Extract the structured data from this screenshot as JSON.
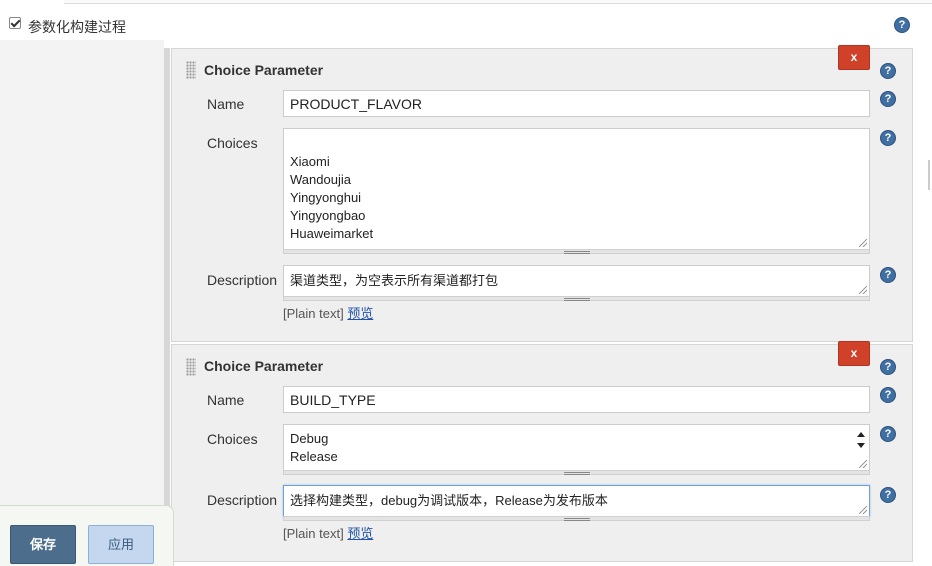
{
  "section": {
    "checkbox_label": "参数化构建过程",
    "checked": true
  },
  "help_glyph": "?",
  "parameters": [
    {
      "title": "Choice Parameter",
      "delete_label": "x",
      "name_label": "Name",
      "name_value": "PRODUCT_FLAVOR",
      "choices_label": "Choices",
      "choices": [
        "",
        "Xiaomi",
        "Wandoujia",
        "Yingyonghui",
        "Yingyongbao",
        "Huaweimarket"
      ],
      "description_label": "Description",
      "description_value": "渠道类型，为空表示所有渠道都打包",
      "format_note": "[Plain text]",
      "preview_link": "预览"
    },
    {
      "title": "Choice Parameter",
      "delete_label": "x",
      "name_label": "Name",
      "name_value": "BUILD_TYPE",
      "choices_label": "Choices",
      "choices": [
        "Debug",
        "Release"
      ],
      "description_label": "Description",
      "description_value": "选择构建类型，debug为调试版本，Release为发布版本",
      "format_note": "[Plain text]",
      "preview_link": "预览"
    }
  ],
  "footer": {
    "save_label": "保存",
    "apply_label": "应用"
  },
  "colors": {
    "delete_button": "#d0412a",
    "save_button": "#4c6d8c",
    "apply_button": "#c4d7ee",
    "help_icon": "#3f6fa3",
    "link": "#2255aa"
  }
}
